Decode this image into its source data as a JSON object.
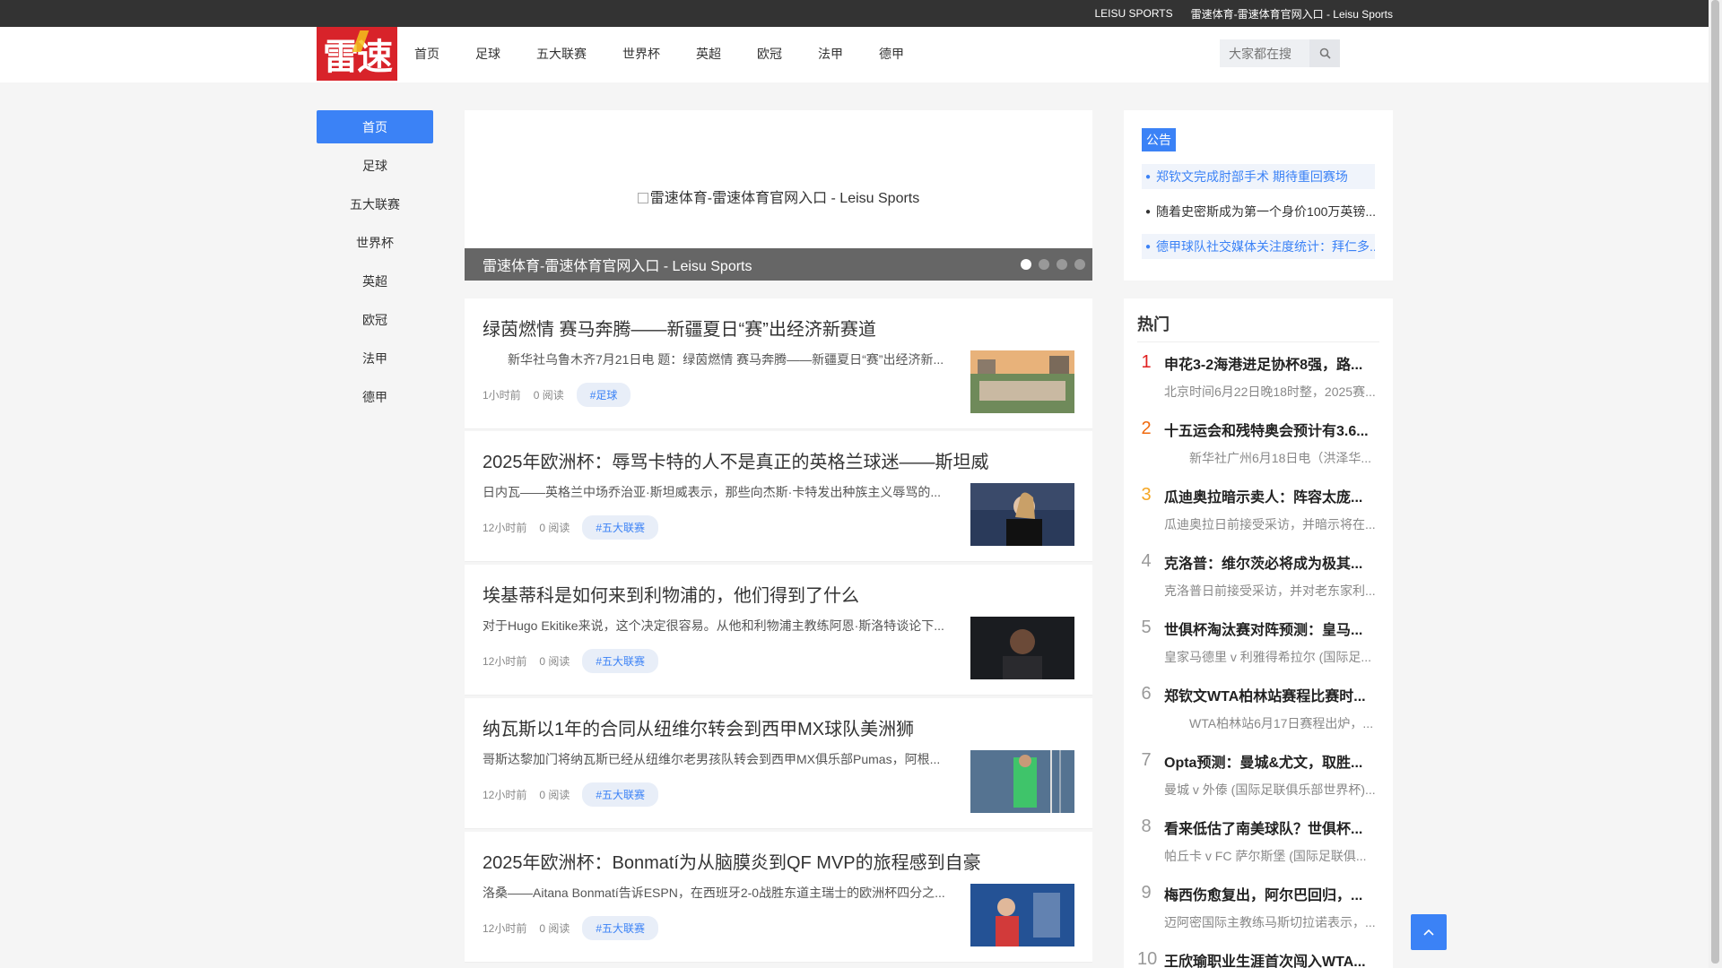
{
  "topbar": {
    "link1": "LEISU SPORTS",
    "link2": "雷速体育-雷速体育官网入口 - Leisu Sports"
  },
  "logo": {
    "text": "雷速"
  },
  "nav": [
    "首页",
    "足球",
    "五大联赛",
    "世界杯",
    "英超",
    "欧冠",
    "法甲",
    "德甲"
  ],
  "search": {
    "placeholder": "大家都在搜",
    "icon": "search-icon"
  },
  "sidebar": [
    "首页",
    "足球",
    "五大联赛",
    "世界杯",
    "英超",
    "欧冠",
    "法甲",
    "德甲"
  ],
  "banner": {
    "alt": "雷速体育-雷速体育官网入口 - Leisu Sports",
    "caption": "雷速体育-雷速体育官网入口 - Leisu Sports",
    "slides": 4,
    "active_slide": 1
  },
  "articles": [
    {
      "title": "绿茵燃情 赛马奔腾——新疆夏日“赛”出经济新赛道",
      "summary": "　　新华社乌鲁木齐7月21日电 题：绿茵燃情 赛马奔腾——新疆夏日“赛”出经济新...",
      "time": "1小时前",
      "reads": "0 阅读",
      "tag": "#足球"
    },
    {
      "title": "2025年欧洲杯：辱骂卡特的人不是真正的英格兰球迷——斯坦威",
      "summary": "日内瓦——英格兰中场乔治亚·斯坦威表示，那些向杰斯·卡特发出种族主义辱骂的...",
      "time": "12小时前",
      "reads": "0 阅读",
      "tag": "#五大联赛"
    },
    {
      "title": "埃基蒂科是如何来到利物浦的，他们得到了什么",
      "summary": "对于Hugo Ekitike来说，这个决定很容易。从他和利物浦主教练阿恩·斯洛特谈论下...",
      "time": "12小时前",
      "reads": "0 阅读",
      "tag": "#五大联赛"
    },
    {
      "title": "纳瓦斯以1年的合同从纽维尔转会到西甲MX球队美洲狮",
      "summary": "哥斯达黎加门将纳瓦斯已经从纽维尔老男孩队转会到西甲MX俱乐部Pumas，阿根...",
      "time": "12小时前",
      "reads": "0 阅读",
      "tag": "#五大联赛"
    },
    {
      "title": "2025年欧洲杯：Bonmatí为从脑膜炎到QF MVP的旅程感到自豪",
      "summary": "洛桑——Aitana Bonmatí告诉ESPN，在西班牙2-0战胜东道主瑞士的欧洲杯四分之...",
      "time": "12小时前",
      "reads": "0 阅读",
      "tag": "#五大联赛"
    }
  ],
  "notice": {
    "label": "公告",
    "items": [
      "郑钦文完成肘部手术 期待重回赛场",
      "随着史密斯成为第一个身价100万英镑...",
      "德甲球队社交媒体关注度统计：拜仁多..."
    ]
  },
  "hot": {
    "title": "热门",
    "items": [
      {
        "rank": "1",
        "title": "申花3-2海港进足协杯8强，路...",
        "desc": "北京时间6月22日晚18时整，2025赛..."
      },
      {
        "rank": "2",
        "title": "十五运会和残特奥会预计有3.6...",
        "desc": "新华社广州6月18日电（洪泽华..."
      },
      {
        "rank": "3",
        "title": "瓜迪奥拉暗示卖人：阵容太庞...",
        "desc": "瓜迪奥拉日前接受采访，并暗示将在..."
      },
      {
        "rank": "4",
        "title": "克洛普：维尔茨必将成为极其...",
        "desc": "克洛普日前接受采访，并对老东家利..."
      },
      {
        "rank": "5",
        "title": "世俱杯淘汰赛对阵预测：皇马...",
        "desc": "皇家马德里 v 利雅得希拉尔 (国际足..."
      },
      {
        "rank": "6",
        "title": "郑钦文WTA柏林站赛程比赛时...",
        "desc": "WTA柏林站6月17日赛程出炉，..."
      },
      {
        "rank": "7",
        "title": "Opta预测：曼城&尤文，取胜...",
        "desc": "曼城 v 外傣 (国际足联俱乐部世界杯)..."
      },
      {
        "rank": "8",
        "title": "看来低估了南美球队？世俱杯...",
        "desc": "帕丘卡 v FC 萨尔斯堡 (国际足联俱..."
      },
      {
        "rank": "9",
        "title": "梅西伤愈复出，阿尔巴回归，...",
        "desc": "迈阿密国际主教练马斯切拉诺表示，..."
      },
      {
        "rank": "10",
        "title": "王欣瑜职业生涯首次闯入WTA...",
        "desc": ""
      }
    ]
  },
  "colors": {
    "accent": "#3b82f6",
    "logo": "#d8232a",
    "topbar": "#333333"
  },
  "totop": {
    "icon": "chevron-up-icon"
  }
}
